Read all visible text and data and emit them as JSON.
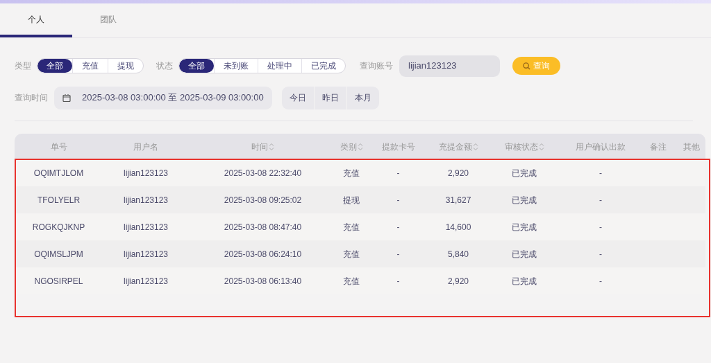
{
  "tabs": [
    {
      "label": "个人",
      "selected": true
    },
    {
      "label": "团队",
      "selected": false
    }
  ],
  "filters": {
    "type_label": "类型",
    "type_options": [
      {
        "label": "全部",
        "selected": true
      },
      {
        "label": "充值",
        "selected": false
      },
      {
        "label": "提现",
        "selected": false
      }
    ],
    "status_label": "状态",
    "status_options": [
      {
        "label": "全部",
        "selected": true
      },
      {
        "label": "未到账",
        "selected": false
      },
      {
        "label": "处理中",
        "selected": false
      },
      {
        "label": "已完成",
        "selected": false
      }
    ],
    "account_label": "查询账号",
    "account_value": "lijian123123",
    "search_button": "查询",
    "time_label": "查询时间",
    "time_range": "2025-03-08 03:00:00 至 2025-03-09 03:00:00",
    "quick_ranges": [
      {
        "label": "今日"
      },
      {
        "label": "昨日"
      },
      {
        "label": "本月"
      }
    ]
  },
  "table": {
    "columns": [
      {
        "label": "单号",
        "sortable": false
      },
      {
        "label": "用户名",
        "sortable": false
      },
      {
        "label": "时间",
        "sortable": true
      },
      {
        "label": "类别",
        "sortable": true
      },
      {
        "label": "提款卡号",
        "sortable": false
      },
      {
        "label": "充提金额",
        "sortable": true
      },
      {
        "label": "审核状态",
        "sortable": true
      },
      {
        "label": "用户确认出款",
        "sortable": false
      },
      {
        "label": "备注",
        "sortable": false
      },
      {
        "label": "其他",
        "sortable": false
      }
    ],
    "rows": [
      [
        "OQIMTJLOM",
        "lijian123123",
        "2025-03-08 22:32:40",
        "充值",
        "-",
        "2,920",
        "已完成",
        "-"
      ],
      [
        "TFOLYELR",
        "lijian123123",
        "2025-03-08 09:25:02",
        "提现",
        "-",
        "31,627",
        "已完成",
        "-"
      ],
      [
        "ROGKQJKNP",
        "lijian123123",
        "2025-03-08 08:47:40",
        "充值",
        "-",
        "14,600",
        "已完成",
        "-"
      ],
      [
        "OQIMSLJPM",
        "lijian123123",
        "2025-03-08 06:24:10",
        "充值",
        "-",
        "5,840",
        "已完成",
        "-"
      ],
      [
        "NGOSIRPEL",
        "lijian123123",
        "2025-03-08 06:13:40",
        "充值",
        "-",
        "2,920",
        "已完成",
        "-"
      ]
    ]
  }
}
